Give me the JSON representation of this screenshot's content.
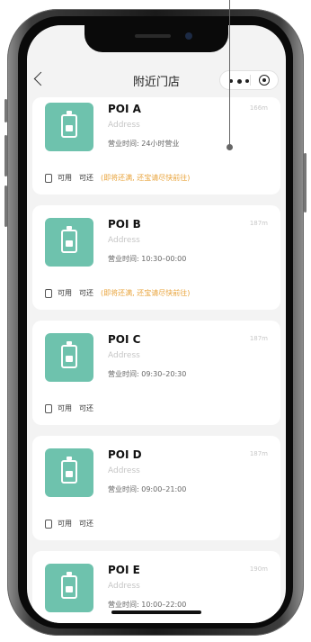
{
  "header": {
    "title": "附近门店"
  },
  "stores": [
    {
      "name": "POI A",
      "address": "Address",
      "hours": "营业时间: 24小时营业",
      "distance": "166m",
      "tags": [
        "可用",
        "可还"
      ],
      "warning": "(即将还满, 还宝请尽快前往)"
    },
    {
      "name": "POI B",
      "address": "Address",
      "hours": "营业时间: 10:30–00:00",
      "distance": "187m",
      "tags": [
        "可用",
        "可还"
      ],
      "warning": "(即将还满, 还宝请尽快前往)"
    },
    {
      "name": "POI C",
      "address": "Address",
      "hours": "营业时间: 09:30–20:30",
      "distance": "187m",
      "tags": [
        "可用",
        "可还"
      ],
      "warning": ""
    },
    {
      "name": "POI D",
      "address": "Address",
      "hours": "营业时间: 09:00–21:00",
      "distance": "187m",
      "tags": [
        "可用",
        "可还"
      ],
      "warning": ""
    },
    {
      "name": "POI E",
      "address": "Address",
      "hours": "营业时间: 10:00–22:00",
      "distance": "190m",
      "tags": [],
      "warning": ""
    }
  ],
  "colors": {
    "accent": "#6ec2ad",
    "warning": "#e8a33a",
    "background": "#f3f3f3"
  },
  "icons": {
    "back": "back-icon",
    "more": "more-icon",
    "target": "target-icon",
    "store": "battery-icon",
    "card": "card-icon"
  }
}
